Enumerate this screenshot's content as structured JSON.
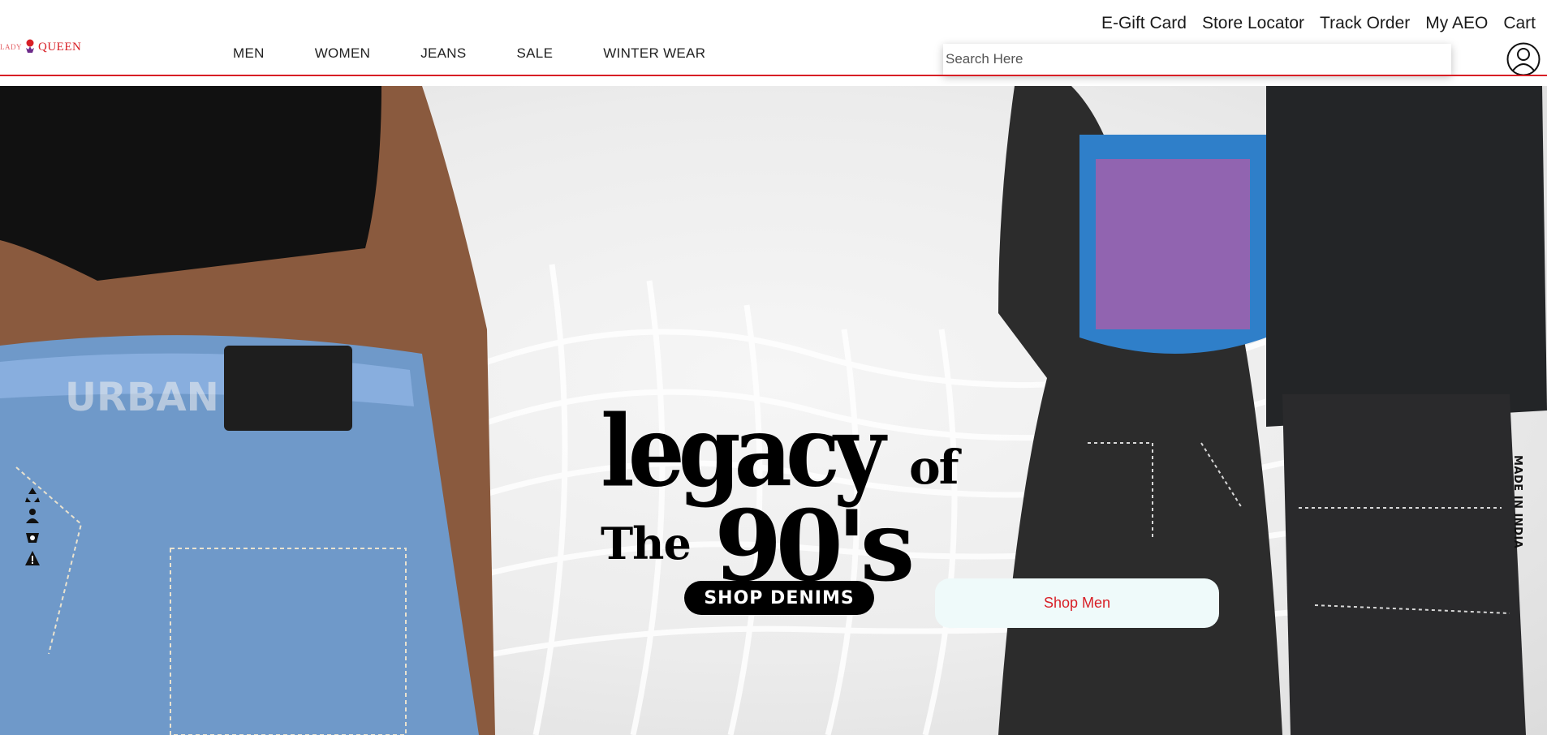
{
  "brand": {
    "logo_text": "QUEEN",
    "logo_prefix": "LADY"
  },
  "top_links": [
    "E-Gift Card",
    "Store Locator",
    "Track Order",
    "My AEO",
    "Cart"
  ],
  "nav": [
    "MEN",
    "WOMEN",
    "JEANS",
    "SALE",
    "WINTER WEAR"
  ],
  "search": {
    "placeholder": "Search Here",
    "value": ""
  },
  "icons": {
    "account": "user-circle-icon",
    "crown": "crown-icon"
  },
  "hero": {
    "headline_word": "legacy",
    "headline_of": "of",
    "headline_the": "The",
    "headline_era": "90's",
    "shop_denims": "SHOP DENIMS",
    "shop_men": "Shop Men",
    "side_text": "MADE IN INDIA",
    "label_text": "URBAN"
  },
  "colors": {
    "brand_red": "#d81f26",
    "button_dark": "#000000",
    "button_light": "#effafa"
  }
}
